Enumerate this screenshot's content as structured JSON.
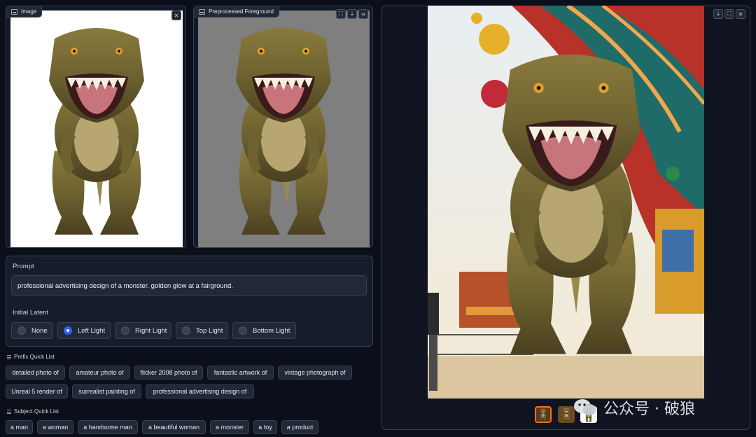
{
  "input_panel": {
    "label": "Image",
    "close_glyph": "✕"
  },
  "preprocessed_panel": {
    "label": "Preprocessed Foreground",
    "fullscreen_glyph": "⛶",
    "download_glyph": "⤓",
    "share_glyph": "⋖"
  },
  "output_panel": {
    "download_glyph": "⤓",
    "fullscreen_glyph": "⛶",
    "close_glyph": "✕"
  },
  "prompt": {
    "label": "Prompt",
    "value": "professional advertising design of a monster. golden glow at a fairground."
  },
  "initial_latent": {
    "label": "Initial Latent",
    "options": [
      "None",
      "Left Light",
      "Right Light",
      "Top Light",
      "Bottom Light"
    ],
    "selected": "Left Light"
  },
  "prefix_quick_list": {
    "label": "Prefix Quick List",
    "items": [
      "detailed photo of",
      "amateur photo of",
      "flicker 2008 photo of",
      "fantastic artwork of",
      "vintage photograph of",
      "Unreal 5 render of",
      "surrealist painting of",
      "professional advertising design of"
    ]
  },
  "subject_quick_list": {
    "label": "Subject Quick List",
    "items": [
      "a man",
      "a woman",
      "a handsome man",
      "a beautiful woman",
      "a monster",
      "a toy",
      "a product"
    ]
  },
  "watermark": {
    "text": "公众号 · 破狼"
  },
  "icons": [
    "image-icon",
    "close-icon",
    "fullscreen-icon",
    "download-icon",
    "share-icon",
    "list-icon",
    "wechat-icon"
  ]
}
